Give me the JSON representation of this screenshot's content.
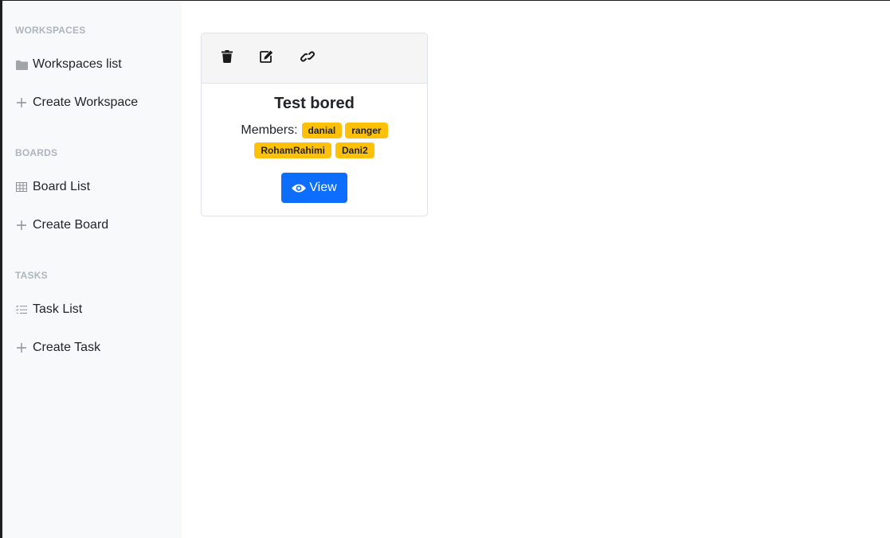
{
  "sidebar": {
    "sections": [
      {
        "heading": "WORKSPACES",
        "items": [
          {
            "label": "Workspaces list",
            "icon": "folder-icon"
          },
          {
            "label": "Create Workspace",
            "icon": "plus-icon"
          }
        ]
      },
      {
        "heading": "BOARDS",
        "items": [
          {
            "label": "Board List",
            "icon": "table-icon"
          },
          {
            "label": "Create Board",
            "icon": "plus-icon"
          }
        ]
      },
      {
        "heading": "TASKS",
        "items": [
          {
            "label": "Task List",
            "icon": "task-list-icon"
          },
          {
            "label": "Create Task",
            "icon": "plus-icon"
          }
        ]
      }
    ]
  },
  "board_card": {
    "actions": [
      {
        "icon": "trash-icon"
      },
      {
        "icon": "edit-icon"
      },
      {
        "icon": "link-icon"
      }
    ],
    "title": "Test bored",
    "members_label": "Members:",
    "members": [
      "danial",
      "ranger",
      "RohamRahimi",
      "Dani2"
    ],
    "view_label": "View"
  },
  "colors": {
    "sidebar_bg": "#f8f9fa",
    "badge": "#ffc107",
    "primary": "#0d6efd",
    "heading": "#adb5bd"
  }
}
